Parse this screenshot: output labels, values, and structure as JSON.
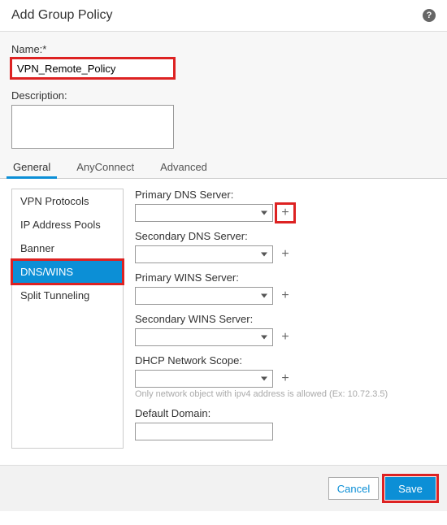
{
  "header": {
    "title": "Add Group Policy"
  },
  "form": {
    "name_label": "Name:*",
    "name_value": "VPN_Remote_Policy",
    "description_label": "Description:",
    "description_value": ""
  },
  "tabs": [
    {
      "label": "General",
      "active": true
    },
    {
      "label": "AnyConnect",
      "active": false
    },
    {
      "label": "Advanced",
      "active": false
    }
  ],
  "sidebar": {
    "items": [
      {
        "label": "VPN Protocols",
        "selected": false
      },
      {
        "label": "IP Address Pools",
        "selected": false
      },
      {
        "label": "Banner",
        "selected": false
      },
      {
        "label": "DNS/WINS",
        "selected": true
      },
      {
        "label": "Split Tunneling",
        "selected": false
      }
    ]
  },
  "settings": {
    "primary_dns": {
      "label": "Primary DNS Server:",
      "value": ""
    },
    "secondary_dns": {
      "label": "Secondary DNS Server:",
      "value": ""
    },
    "primary_wins": {
      "label": "Primary WINS Server:",
      "value": ""
    },
    "secondary_wins": {
      "label": "Secondary WINS Server:",
      "value": ""
    },
    "dhcp_scope": {
      "label": "DHCP Network Scope:",
      "value": "",
      "hint": "Only network object with ipv4 address is allowed (Ex: 10.72.3.5)"
    },
    "default_domain": {
      "label": "Default Domain:",
      "value": ""
    }
  },
  "footer": {
    "cancel": "Cancel",
    "save": "Save"
  }
}
